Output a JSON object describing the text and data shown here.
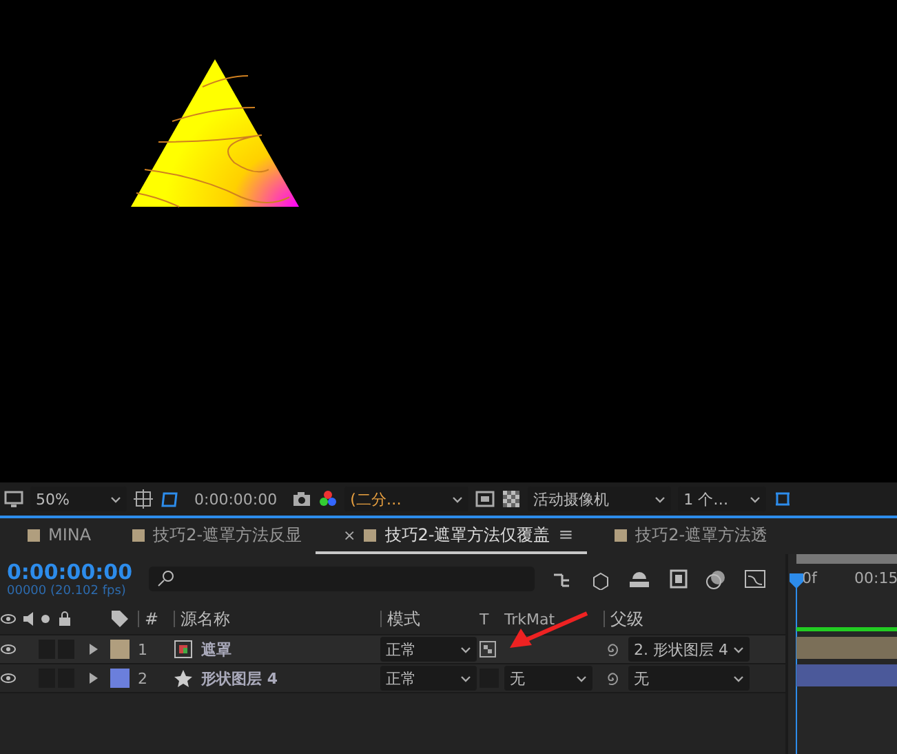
{
  "viewer_toolbar": {
    "zoom": "50%",
    "timecode": "0:00:00:00",
    "resolution": "(二分…",
    "camera": "活动摄像机",
    "views": "1 个…"
  },
  "tabs": [
    {
      "label": "MINA",
      "color": "#b09e7e",
      "selected": false
    },
    {
      "label": "技巧2-遮罩方法反显",
      "color": "#b09e7e",
      "selected": false
    },
    {
      "label": "技巧2-遮罩方法仅覆盖",
      "color": "#b09e7e",
      "selected": true,
      "close": "×",
      "menu": "≡"
    },
    {
      "label": "技巧2-遮罩方法透",
      "color": "#b09e7e",
      "selected": false
    }
  ],
  "composition": {
    "timecode": "0:00:00:00",
    "frame_info": "00000 (20.102 fps)"
  },
  "columns": {
    "number": "#",
    "source_name": "源名称",
    "mode": "模式",
    "t": "T",
    "trkmat": "TrkMat",
    "parent": "父级"
  },
  "ruler": {
    "start": "0f",
    "mark": "00:15"
  },
  "layers": [
    {
      "number": "1",
      "name": "遮罩",
      "kind": "footage",
      "color": "#b09e7e",
      "mode": "正常",
      "parent": "2. 形状图层 4"
    },
    {
      "number": "2",
      "name": "形状图层 4",
      "kind": "shape",
      "color": "#6b7fdc",
      "mode": "正常",
      "trkmat": "无",
      "parent": "无"
    }
  ]
}
